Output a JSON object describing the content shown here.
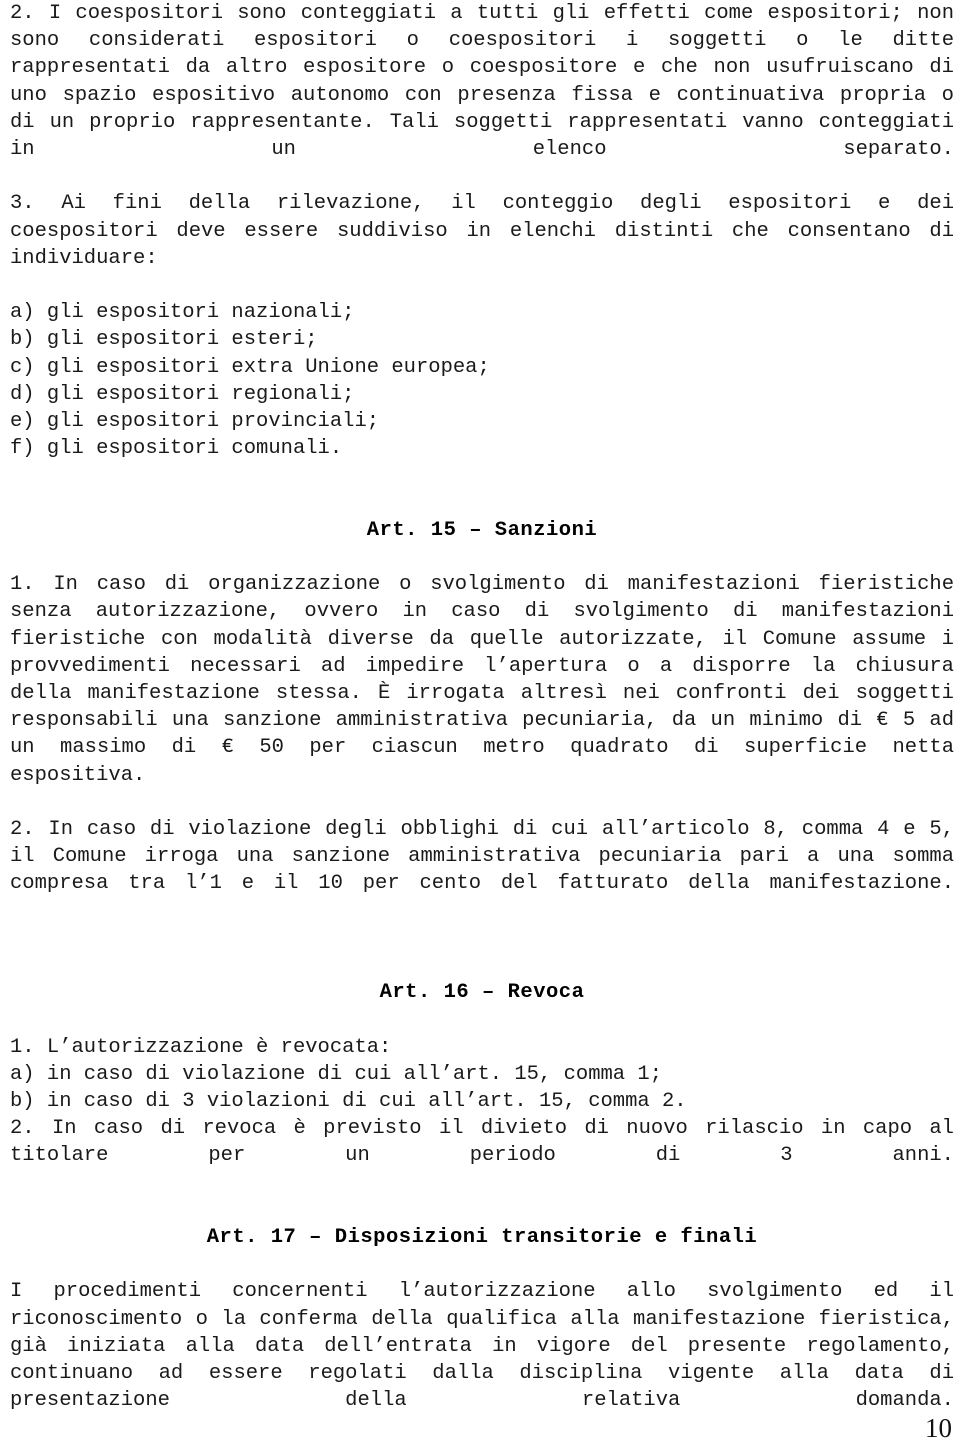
{
  "document": {
    "page_number": "10",
    "background_color": "#ffffff",
    "text_color": "#1a1a1a",
    "heading_color": "#000000"
  },
  "blocks": [
    {
      "kind": "paragraph",
      "name": "article-14-comma-2",
      "text": "2. I coespositori sono conteggiati a tutti gli effetti come espositori; non sono considerati espositori o coespositori i soggetti o le ditte rappresentati da altro espositore o coespositore e che non usufruiscano di uno spazio espositivo autonomo con presenza fissa e continuativa propria o di un proprio rappresentante. Tali soggetti rappresentati vanno conteggiati in un elenco separato."
    },
    {
      "kind": "paragraph",
      "name": "article-14-comma-3",
      "text": "3. Ai fini della rilevazione, il conteggio degli espositori e dei coespositori deve essere suddiviso in elenchi distinti che consentano di individuare:"
    },
    {
      "kind": "line",
      "name": "list-item-a-nazionali",
      "text": "a) gli espositori nazionali;"
    },
    {
      "kind": "line",
      "name": "list-item-b-esteri",
      "text": "b) gli espositori esteri;"
    },
    {
      "kind": "line",
      "name": "list-item-c-extra-ue",
      "text": "c) gli espositori extra Unione europea;"
    },
    {
      "kind": "line",
      "name": "list-item-d-regionali",
      "text": "d) gli espositori regionali;"
    },
    {
      "kind": "line",
      "name": "list-item-e-provinciali",
      "text": "e) gli espositori provinciali;"
    },
    {
      "kind": "line",
      "name": "list-item-f-comunali",
      "text": "f) gli espositori comunali."
    },
    {
      "kind": "spacer",
      "name": "spacer-before-art-15",
      "size": 2
    },
    {
      "kind": "heading",
      "name": "heading-art-15",
      "text": "Art. 15 – Sanzioni"
    },
    {
      "kind": "spacer",
      "name": "spacer-after-art-15",
      "size": 1
    },
    {
      "kind": "paragraph",
      "name": "article-15-comma-1",
      "text": "1. In caso di organizzazione o svolgimento di manifestazioni fieristiche senza autorizzazione, ovvero in caso di svolgimento di manifestazioni fieristiche con modalità diverse da quelle autorizzate, il Comune assume i provvedimenti necessari ad impedire l’apertura o a disporre la chiusura della manifestazione stessa. È irrogata altresì nei confronti dei soggetti responsabili una sanzione amministrativa pecuniaria, da un minimo di € 5 ad un massimo di € 50 per ciascun metro quadrato di superficie netta espositiva."
    },
    {
      "kind": "paragraph",
      "name": "article-15-comma-2",
      "text": "2. In caso di violazione degli obblighi di cui all’articolo 8, comma 4 e 5, il Comune irroga una sanzione amministrativa pecuniaria pari a una somma compresa tra l’1 e il 10 per cento del fatturato della manifestazione."
    },
    {
      "kind": "spacer",
      "name": "spacer-before-art-16",
      "size": 2
    },
    {
      "kind": "heading",
      "name": "heading-art-16",
      "text": "Art. 16 – Revoca"
    },
    {
      "kind": "spacer",
      "name": "spacer-after-art-16",
      "size": 1
    },
    {
      "kind": "line",
      "name": "article-16-comma-1",
      "text": "1. L’autorizzazione è revocata:"
    },
    {
      "kind": "line",
      "name": "article-16-item-a",
      "text": "a) in caso di violazione di cui all’art. 15, comma 1;"
    },
    {
      "kind": "line",
      "name": "article-16-item-b",
      "text": "b) in caso di 3 violazioni di cui all’art. 15, comma 2."
    },
    {
      "kind": "paragraph",
      "name": "article-16-comma-2",
      "text": "2. In caso di revoca è previsto il divieto di nuovo rilascio in capo al titolare per un periodo di 3 anni."
    },
    {
      "kind": "spacer",
      "name": "spacer-before-art-17",
      "size": 1
    },
    {
      "kind": "heading",
      "name": "heading-art-17",
      "text": "Art. 17 – Disposizioni transitorie e finali"
    },
    {
      "kind": "spacer",
      "name": "spacer-after-art-17",
      "size": 1
    },
    {
      "kind": "paragraph",
      "name": "article-17-body",
      "text": "I procedimenti concernenti l’autorizzazione allo svolgimento ed il riconoscimento o la conferma della qualifica alla manifestazione fieristica, già iniziata alla data dell’entrata in vigore del presente regolamento, continuano ad essere regolati dalla disciplina vigente alla data di presentazione della relativa domanda."
    }
  ]
}
